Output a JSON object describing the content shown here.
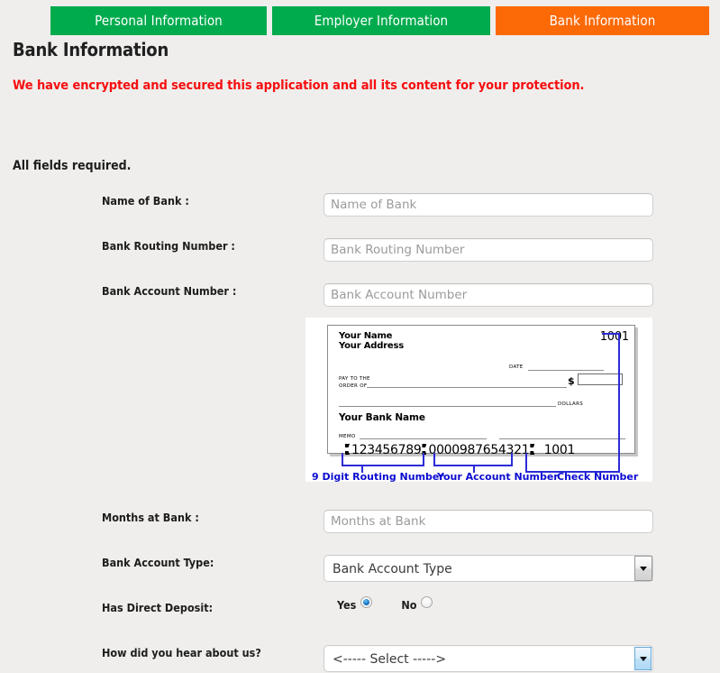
{
  "tabs": [
    {
      "label": "Personal Information",
      "active": false,
      "color": "#00ab4e"
    },
    {
      "label": "Employer Information",
      "active": false,
      "color": "#00ab4e"
    },
    {
      "label": "Bank Information",
      "active": true,
      "color": "#fc6a08"
    }
  ],
  "header": {
    "title": "Bank Information",
    "notice": "We have encrypted and secured this application and all its content for your protection.",
    "notice_color": "#f60e10",
    "required_note": "All fields required."
  },
  "form": {
    "bank_name": {
      "label": "Name of Bank :",
      "placeholder": "Name of Bank",
      "value": ""
    },
    "routing_number": {
      "label": "Bank Routing Number :",
      "placeholder": "Bank Routing Number",
      "value": ""
    },
    "account_number": {
      "label": "Bank Account Number :",
      "placeholder": "Bank Account Number",
      "value": ""
    },
    "months_at_bank": {
      "label": "Months at Bank :",
      "placeholder": "Months at Bank",
      "value": ""
    },
    "account_type": {
      "label": "Bank Account Type:",
      "selected": "Bank Account Type"
    },
    "direct_deposit": {
      "label": "Has Direct Deposit:",
      "options": [
        {
          "label": "Yes",
          "checked": true
        },
        {
          "label": "No",
          "checked": false
        }
      ]
    },
    "hear_about_us": {
      "label": "How did you hear about us?",
      "selected": "<----- Select ----->"
    }
  },
  "check_sample": {
    "your_name": "Your Name",
    "your_address": "Your Address",
    "check_number": "1001",
    "date_label": "DATE",
    "pay_to_line1": "PAY TO THE",
    "pay_to_line2": "ORDER OF",
    "dollar_sign": "$",
    "dollars_label": "DOLLARS",
    "bank_name": "Your Bank Name",
    "memo_label": "MEMO",
    "micr_routing": "123456789",
    "micr_account": "0000987654321",
    "micr_check_number": "1001",
    "annotations": {
      "routing": "9 Digit Routing Number",
      "account": "Your Account Number",
      "check": "Check Number",
      "color": "#0b0bd0"
    }
  }
}
